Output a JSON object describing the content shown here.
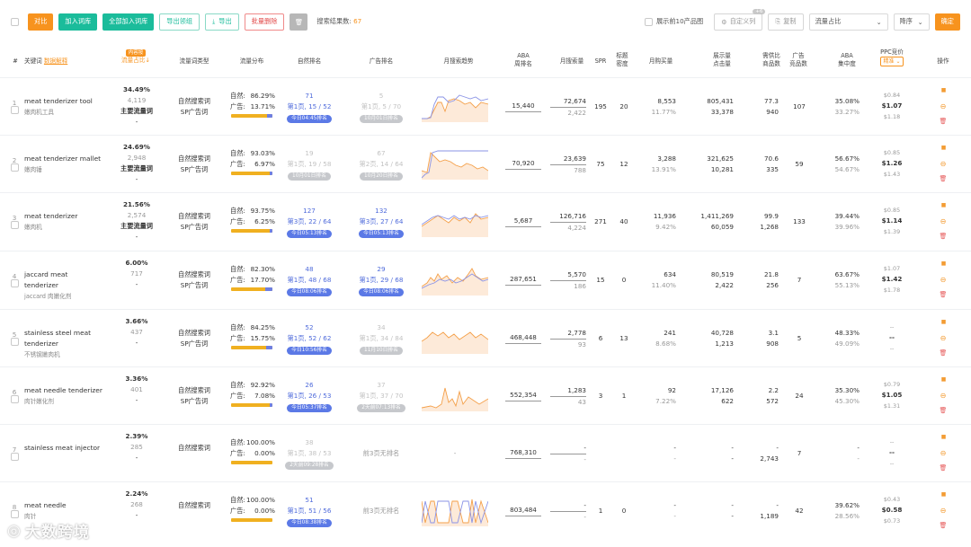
{
  "toolbar": {
    "compare": "对比",
    "add_to_lib": "加入词库",
    "add_all_to_lib": "全部加入词库",
    "export_selected": "导出领组",
    "export": "导出",
    "batch_delete": "批量删除",
    "result_count_label": "搜索结果数:",
    "result_count": "67",
    "show_top10": "展示前10产品图",
    "custom_columns": "自定义列",
    "custom_badge": "+6",
    "copy": "复制",
    "sort_field": "流量占比",
    "sort_order": "降序",
    "confirm": "确定"
  },
  "headers": {
    "index": "#",
    "keyword": "关键词",
    "data_explain": "数据解释",
    "flow_share_tag": "内容按",
    "flow_share": "流量占比↓",
    "flow_type": "流量词类型",
    "flow_dist": "流量分布",
    "natural_rank": "自然排名",
    "ad_rank": "广告排名",
    "monthly_trend": "月搜索趋势",
    "aba_rank_1": "ABA",
    "aba_rank_2": "周排名",
    "monthly_search": "月搜索量",
    "spr": "SPR",
    "title_density_1": "标题",
    "title_density_2": "密度",
    "monthly_sales": "月购买量",
    "impressions_1": "展示量",
    "impressions_2": "点击量",
    "supply_demand_1": "需供比",
    "supply_demand_2": "商品数",
    "ad_products_1": "广告",
    "ad_products_2": "竞品数",
    "aba_conc_1": "ABA",
    "aba_conc_2": "集中度",
    "ppc_1": "PPC竞价",
    "ppc_tag": "精准",
    "ops": "操作"
  },
  "rows": [
    {
      "idx": "1",
      "kw": "meat tenderizer tool",
      "kw_cn": "嫩肉机工具",
      "share": "34.49%",
      "share_n": "4,119",
      "share_type": "主要流量词",
      "share_dash": "-",
      "t1": "自然搜索词",
      "t2": "SP广告词",
      "nat_pct": "86.29%",
      "ad_pct": "13.71%",
      "nat_rank": "71",
      "nat_page": "第1页, 15 / 52",
      "nat_pill": "今日04:45排名",
      "nat_pill_grey": false,
      "ad_rank": "5",
      "ad_page": "第1页, 5 / 70",
      "ad_pill": "10月01日排名",
      "ad_pill_grey": true,
      "ad_grey": true,
      "aba": "15,440",
      "ms1": "72,674",
      "ms2": "2,422",
      "spr": "195",
      "td": "20",
      "sales1": "8,553",
      "sales2": "11.77%",
      "imp1": "805,431",
      "imp2": "33,378",
      "sd1": "77.3",
      "sd2": "940",
      "adp": "107",
      "conc1": "35.08%",
      "conc2": "33.27%",
      "ppc1": "$0.84",
      "ppc2": "$1.07",
      "ppc3": "$1.18",
      "spark": "a"
    },
    {
      "idx": "2",
      "kw": "meat tenderizer mallet",
      "kw_cn": "嫩肉锤",
      "share": "24.69%",
      "share_n": "2,948",
      "share_type": "主要流量词",
      "share_dash": "-",
      "t1": "自然搜索词",
      "t2": "SP广告词",
      "nat_pct": "93.03%",
      "ad_pct": "6.97%",
      "nat_rank": "19",
      "nat_page": "第1页, 19 / 58",
      "nat_pill": "10月01日排名",
      "nat_pill_grey": true,
      "ad_rank": "67",
      "ad_page": "第2页, 14 / 64",
      "ad_pill": "10月20日排名",
      "ad_pill_grey": true,
      "ad_grey": true,
      "nat_grey": true,
      "aba": "70,920",
      "ms1": "23,639",
      "ms2": "788",
      "spr": "75",
      "td": "12",
      "sales1": "3,288",
      "sales2": "13.91%",
      "imp1": "321,625",
      "imp2": "10,281",
      "sd1": "70.6",
      "sd2": "335",
      "adp": "59",
      "conc1": "56.67%",
      "conc2": "54.67%",
      "ppc1": "$0.85",
      "ppc2": "$1.26",
      "ppc3": "$1.43",
      "spark": "b"
    },
    {
      "idx": "3",
      "kw": "meat tenderizer",
      "kw_cn": "嫩肉机",
      "share": "21.56%",
      "share_n": "2,574",
      "share_type": "主要流量词",
      "share_dash": "-",
      "t1": "自然搜索词",
      "t2": "SP广告词",
      "nat_pct": "93.75%",
      "ad_pct": "6.25%",
      "nat_rank": "127",
      "nat_page": "第3页, 22 / 64",
      "nat_pill": "今日05:13排名",
      "nat_pill_grey": false,
      "ad_rank": "132",
      "ad_page": "第3页, 27 / 64",
      "ad_pill": "今日05:13排名",
      "ad_pill_grey": false,
      "aba": "5,687",
      "ms1": "126,716",
      "ms2": "4,224",
      "spr": "271",
      "td": "40",
      "sales1": "11,936",
      "sales2": "9.42%",
      "imp1": "1,411,269",
      "imp2": "60,059",
      "sd1": "99.9",
      "sd2": "1,268",
      "adp": "133",
      "conc1": "39.44%",
      "conc2": "39.96%",
      "ppc1": "$0.85",
      "ppc2": "$1.14",
      "ppc3": "$1.39",
      "spark": "c"
    },
    {
      "idx": "4",
      "kw": "jaccard meat tenderizer",
      "kw_cn": "jaccard 肉嫩化剂",
      "share": "6.00%",
      "share_n": "717",
      "share_type": "",
      "share_dash": "-",
      "t1": "自然搜索词",
      "t2": "SP广告词",
      "nat_pct": "82.30%",
      "ad_pct": "17.70%",
      "nat_rank": "48",
      "nat_page": "第1页, 48 / 68",
      "nat_pill": "今日08:06排名",
      "nat_pill_grey": false,
      "ad_rank": "29",
      "ad_page": "第1页, 29 / 68",
      "ad_pill": "今日08:06排名",
      "ad_pill_grey": false,
      "aba": "287,651",
      "ms1": "5,570",
      "ms2": "186",
      "spr": "15",
      "td": "0",
      "sales1": "634",
      "sales2": "11.40%",
      "imp1": "80,519",
      "imp2": "2,422",
      "sd1": "21.8",
      "sd2": "256",
      "adp": "7",
      "conc1": "63.67%",
      "conc2": "55.13%",
      "ppc1": "$1.07",
      "ppc2": "$1.42",
      "ppc3": "$1.78",
      "spark": "d"
    },
    {
      "idx": "5",
      "kw": "stainless steel meat tenderizer",
      "kw_cn": "不锈钢嫩肉机",
      "share": "3.66%",
      "share_n": "437",
      "share_type": "",
      "share_dash": "-",
      "t1": "自然搜索词",
      "t2": "SP广告词",
      "nat_pct": "84.25%",
      "ad_pct": "15.75%",
      "nat_rank": "52",
      "nat_page": "第1页, 52 / 62",
      "nat_pill": "今日10:56排名",
      "nat_pill_grey": false,
      "ad_rank": "34",
      "ad_page": "第1页, 34 / 84",
      "ad_pill": "11月10日排名",
      "ad_pill_grey": true,
      "ad_grey": true,
      "aba": "468,448",
      "ms1": "2,778",
      "ms2": "93",
      "spr": "6",
      "td": "13",
      "sales1": "241",
      "sales2": "8.68%",
      "imp1": "40,728",
      "imp2": "1,213",
      "sd1": "3.1",
      "sd2": "908",
      "adp": "5",
      "conc1": "48.33%",
      "conc2": "49.09%",
      "ppc1": "--",
      "ppc2": "--",
      "ppc3": "--",
      "spark": "e"
    },
    {
      "idx": "6",
      "kw": "meat needle tenderizer",
      "kw_cn": "肉针嫩化剂",
      "share": "3.36%",
      "share_n": "401",
      "share_type": "",
      "share_dash": "-",
      "t1": "自然搜索词",
      "t2": "SP广告词",
      "nat_pct": "92.92%",
      "ad_pct": "7.08%",
      "nat_rank": "26",
      "nat_page": "第1页, 26 / 53",
      "nat_pill": "今日05:37排名",
      "nat_pill_grey": false,
      "ad_rank": "37",
      "ad_page": "第1页, 37 / 70",
      "ad_pill": "2天前07:13排名",
      "ad_pill_grey": true,
      "ad_grey": true,
      "aba": "552,354",
      "ms1": "1,283",
      "ms2": "43",
      "spr": "3",
      "td": "1",
      "sales1": "92",
      "sales2": "7.22%",
      "imp1": "17,126",
      "imp2": "622",
      "sd1": "2.2",
      "sd2": "572",
      "adp": "24",
      "conc1": "35.30%",
      "conc2": "45.30%",
      "ppc1": "$0.79",
      "ppc2": "$1.05",
      "ppc3": "$1.31",
      "spark": "f"
    },
    {
      "idx": "7",
      "kw": "stainless meat injector",
      "kw_cn": "",
      "share": "2.39%",
      "share_n": "285",
      "share_type": "",
      "share_dash": "-",
      "t1": "自然搜索词",
      "t2": "",
      "nat_pct": "100.00%",
      "ad_pct": "0.00%",
      "nat_rank": "38",
      "nat_page": "第1页, 38 / 53",
      "nat_pill": "2天前09:28排名",
      "nat_pill_grey": true,
      "nat_grey": true,
      "ad_rank": "",
      "ad_page": "前3页无排名",
      "ad_pill": "",
      "ad_none": true,
      "aba": "768,310",
      "ms1": "-",
      "ms2": "-",
      "spr": "",
      "td": "",
      "sales1": "-",
      "sales2": "-",
      "imp1": "-",
      "imp2": "-",
      "sd1": "-",
      "sd2": "2,743",
      "adp": "7",
      "conc1": "-",
      "conc2": "-",
      "ppc1": "--",
      "ppc2": "--",
      "ppc3": "--",
      "spark": "none",
      "trend_dash": "-"
    },
    {
      "idx": "8",
      "kw": "meat needle",
      "kw_cn": "肉针",
      "share": "2.24%",
      "share_n": "268",
      "share_type": "",
      "share_dash": "-",
      "t1": "自然搜索词",
      "t2": "",
      "nat_pct": "100.00%",
      "ad_pct": "0.00%",
      "nat_rank": "51",
      "nat_page": "第1页, 51 / 56",
      "nat_pill": "今日08:38排名",
      "nat_pill_grey": false,
      "ad_rank": "",
      "ad_page": "前3页无排名",
      "ad_pill": "",
      "ad_none": true,
      "aba": "803,484",
      "ms1": "-",
      "ms2": "-",
      "spr": "1",
      "td": "0",
      "sales1": "-",
      "sales2": "-",
      "imp1": "-",
      "imp2": "-",
      "sd1": "-",
      "sd2": "1,189",
      "adp": "42",
      "conc1": "39.62%",
      "conc2": "28.56%",
      "ppc1": "$0.43",
      "ppc2": "$0.58",
      "ppc3": "$0.73",
      "spark": "h"
    }
  ],
  "labels": {
    "natural": "自然:",
    "ad": "广告:"
  },
  "watermark": "大数跨境",
  "colors": {
    "accent": "#f7931e",
    "green": "#1bbc9b",
    "blue": "#4f6bdb",
    "nat_bar": "#f0b020",
    "ad_bar": "#6f7fe0"
  }
}
